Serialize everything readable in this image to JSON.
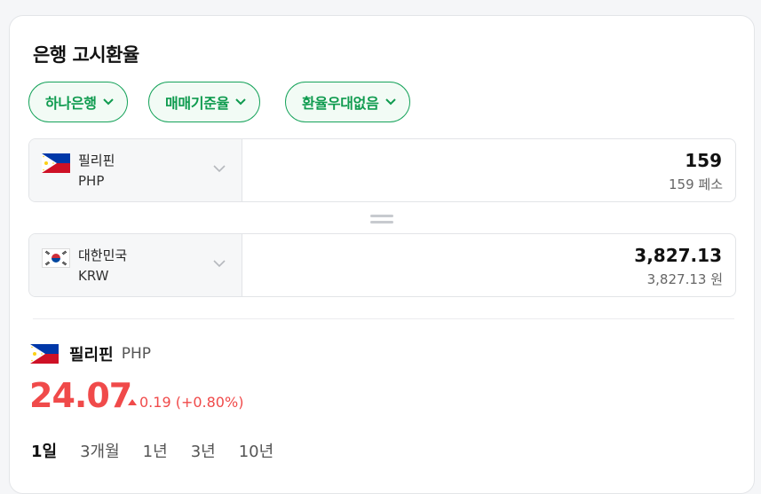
{
  "title": "은행 고시환율",
  "filters": [
    {
      "label": "하나은행"
    },
    {
      "label": "매매기준율"
    },
    {
      "label": "환율우대없음"
    }
  ],
  "from": {
    "name": "필리핀",
    "code": "PHP",
    "amount": "159",
    "amount_text": "159 페소",
    "flag": "philippines-flag"
  },
  "to": {
    "name": "대한민국",
    "code": "KRW",
    "amount": "3,827.13",
    "amount_text": "3,827.13 원",
    "flag": "korea-flag"
  },
  "rate": {
    "name": "필리핀",
    "code": "PHP",
    "value": "24.07",
    "change": "0.19 (+0.80%)",
    "direction": "up"
  },
  "periods": [
    {
      "label": "1일",
      "active": true
    },
    {
      "label": "3개월",
      "active": false
    },
    {
      "label": "1년",
      "active": false
    },
    {
      "label": "3년",
      "active": false
    },
    {
      "label": "10년",
      "active": false
    }
  ],
  "colors": {
    "accent": "#0f9b4f",
    "up": "#f04a4a"
  }
}
